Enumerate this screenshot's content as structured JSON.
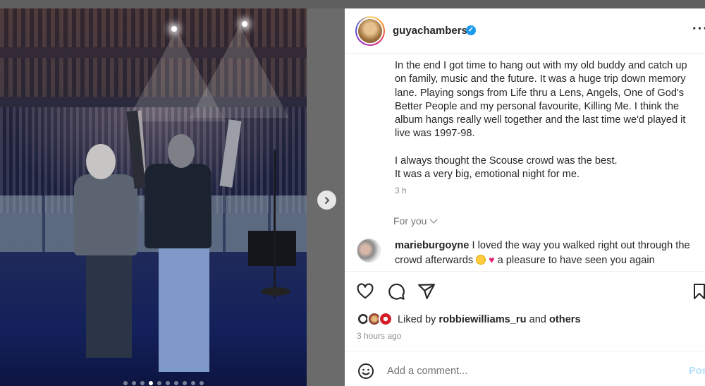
{
  "post": {
    "username": "guyachambers",
    "verified": true,
    "caption_paragraphs": [
      "In the end I got time to hang out with my old buddy and catch up on family, music and the future. It was a huge trip down memory lane. Playing songs from Life thru a Lens, Angels, One of God's Better People and my personal favourite, Killing Me. I think the album hangs really well together and the last time we'd played it live was 1997-98.",
      "I always thought the Scouse crowd was the best.\nIt was a very big, emotional night for me."
    ],
    "caption_time": "3 h",
    "photo_carousel": {
      "dot_count": 10,
      "active_index": 3
    }
  },
  "for_you": {
    "label": "For you"
  },
  "comments": [
    {
      "username": "marieburgoyne",
      "text_before_emoji": "I loved the way you walked right out through the crowd afterwards",
      "emojis": [
        "smiling-face-with-hearts",
        "heart"
      ],
      "text_after_emoji": "a pleasure to have seen you again"
    }
  ],
  "likes": {
    "prefix": "Liked by",
    "user": "robbiewilliams_ru",
    "conjunction": "and",
    "others": "others"
  },
  "posted_ago": "3 hours ago",
  "comment_box": {
    "placeholder": "Add a comment...",
    "post_label": "Post"
  },
  "icons": [
    "heart-icon",
    "comment-icon",
    "share-icon",
    "bookmark-icon",
    "emoji-icon",
    "more-options-icon",
    "next-arrow-icon",
    "verified-badge-icon"
  ],
  "colors": {
    "verified": "#1d9bf0",
    "post_button": "#b2dffc",
    "muted_text": "#8e8e8e"
  }
}
